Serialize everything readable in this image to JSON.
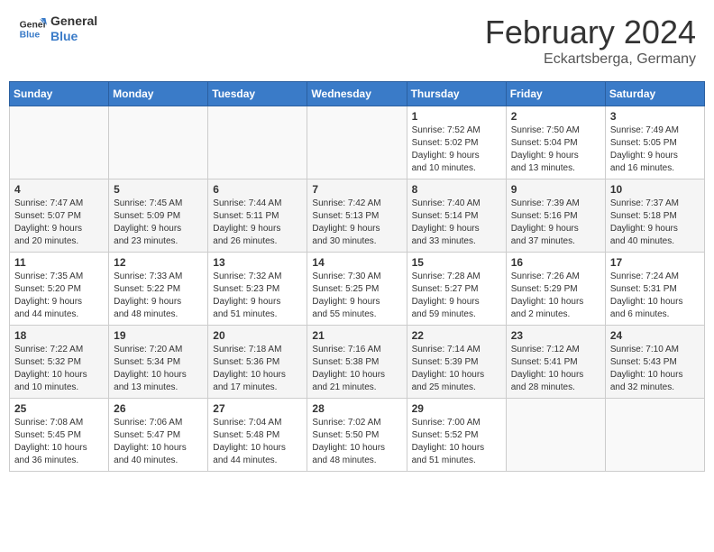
{
  "logo": {
    "line1": "General",
    "line2": "Blue"
  },
  "title": "February 2024",
  "subtitle": "Eckartsberga, Germany",
  "days_of_week": [
    "Sunday",
    "Monday",
    "Tuesday",
    "Wednesday",
    "Thursday",
    "Friday",
    "Saturday"
  ],
  "weeks": [
    [
      {
        "day": "",
        "info": ""
      },
      {
        "day": "",
        "info": ""
      },
      {
        "day": "",
        "info": ""
      },
      {
        "day": "",
        "info": ""
      },
      {
        "day": "1",
        "info": "Sunrise: 7:52 AM\nSunset: 5:02 PM\nDaylight: 9 hours\nand 10 minutes."
      },
      {
        "day": "2",
        "info": "Sunrise: 7:50 AM\nSunset: 5:04 PM\nDaylight: 9 hours\nand 13 minutes."
      },
      {
        "day": "3",
        "info": "Sunrise: 7:49 AM\nSunset: 5:05 PM\nDaylight: 9 hours\nand 16 minutes."
      }
    ],
    [
      {
        "day": "4",
        "info": "Sunrise: 7:47 AM\nSunset: 5:07 PM\nDaylight: 9 hours\nand 20 minutes."
      },
      {
        "day": "5",
        "info": "Sunrise: 7:45 AM\nSunset: 5:09 PM\nDaylight: 9 hours\nand 23 minutes."
      },
      {
        "day": "6",
        "info": "Sunrise: 7:44 AM\nSunset: 5:11 PM\nDaylight: 9 hours\nand 26 minutes."
      },
      {
        "day": "7",
        "info": "Sunrise: 7:42 AM\nSunset: 5:13 PM\nDaylight: 9 hours\nand 30 minutes."
      },
      {
        "day": "8",
        "info": "Sunrise: 7:40 AM\nSunset: 5:14 PM\nDaylight: 9 hours\nand 33 minutes."
      },
      {
        "day": "9",
        "info": "Sunrise: 7:39 AM\nSunset: 5:16 PM\nDaylight: 9 hours\nand 37 minutes."
      },
      {
        "day": "10",
        "info": "Sunrise: 7:37 AM\nSunset: 5:18 PM\nDaylight: 9 hours\nand 40 minutes."
      }
    ],
    [
      {
        "day": "11",
        "info": "Sunrise: 7:35 AM\nSunset: 5:20 PM\nDaylight: 9 hours\nand 44 minutes."
      },
      {
        "day": "12",
        "info": "Sunrise: 7:33 AM\nSunset: 5:22 PM\nDaylight: 9 hours\nand 48 minutes."
      },
      {
        "day": "13",
        "info": "Sunrise: 7:32 AM\nSunset: 5:23 PM\nDaylight: 9 hours\nand 51 minutes."
      },
      {
        "day": "14",
        "info": "Sunrise: 7:30 AM\nSunset: 5:25 PM\nDaylight: 9 hours\nand 55 minutes."
      },
      {
        "day": "15",
        "info": "Sunrise: 7:28 AM\nSunset: 5:27 PM\nDaylight: 9 hours\nand 59 minutes."
      },
      {
        "day": "16",
        "info": "Sunrise: 7:26 AM\nSunset: 5:29 PM\nDaylight: 10 hours\nand 2 minutes."
      },
      {
        "day": "17",
        "info": "Sunrise: 7:24 AM\nSunset: 5:31 PM\nDaylight: 10 hours\nand 6 minutes."
      }
    ],
    [
      {
        "day": "18",
        "info": "Sunrise: 7:22 AM\nSunset: 5:32 PM\nDaylight: 10 hours\nand 10 minutes."
      },
      {
        "day": "19",
        "info": "Sunrise: 7:20 AM\nSunset: 5:34 PM\nDaylight: 10 hours\nand 13 minutes."
      },
      {
        "day": "20",
        "info": "Sunrise: 7:18 AM\nSunset: 5:36 PM\nDaylight: 10 hours\nand 17 minutes."
      },
      {
        "day": "21",
        "info": "Sunrise: 7:16 AM\nSunset: 5:38 PM\nDaylight: 10 hours\nand 21 minutes."
      },
      {
        "day": "22",
        "info": "Sunrise: 7:14 AM\nSunset: 5:39 PM\nDaylight: 10 hours\nand 25 minutes."
      },
      {
        "day": "23",
        "info": "Sunrise: 7:12 AM\nSunset: 5:41 PM\nDaylight: 10 hours\nand 28 minutes."
      },
      {
        "day": "24",
        "info": "Sunrise: 7:10 AM\nSunset: 5:43 PM\nDaylight: 10 hours\nand 32 minutes."
      }
    ],
    [
      {
        "day": "25",
        "info": "Sunrise: 7:08 AM\nSunset: 5:45 PM\nDaylight: 10 hours\nand 36 minutes."
      },
      {
        "day": "26",
        "info": "Sunrise: 7:06 AM\nSunset: 5:47 PM\nDaylight: 10 hours\nand 40 minutes."
      },
      {
        "day": "27",
        "info": "Sunrise: 7:04 AM\nSunset: 5:48 PM\nDaylight: 10 hours\nand 44 minutes."
      },
      {
        "day": "28",
        "info": "Sunrise: 7:02 AM\nSunset: 5:50 PM\nDaylight: 10 hours\nand 48 minutes."
      },
      {
        "day": "29",
        "info": "Sunrise: 7:00 AM\nSunset: 5:52 PM\nDaylight: 10 hours\nand 51 minutes."
      },
      {
        "day": "",
        "info": ""
      },
      {
        "day": "",
        "info": ""
      }
    ]
  ]
}
